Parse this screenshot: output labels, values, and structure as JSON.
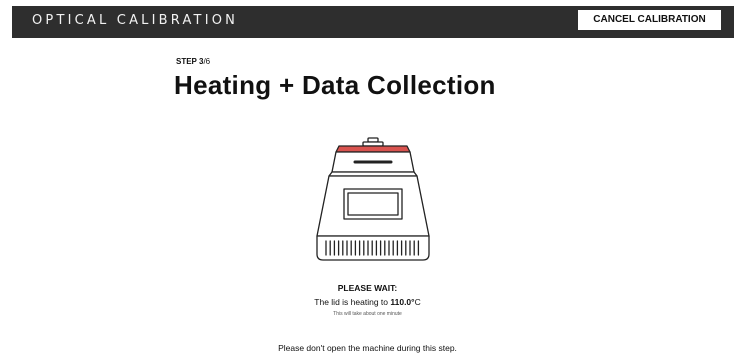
{
  "header": {
    "title": "OPTICAL CALIBRATION",
    "cancel_label": "CANCEL CALIBRATION"
  },
  "step": {
    "prefix": "STEP ",
    "current": "3",
    "total": "/6"
  },
  "main": {
    "title": "Heating + Data Collection"
  },
  "status": {
    "heading": "PLEASE WAIT:",
    "heating_prefix": "The lid is heating to ",
    "temperature": "110.0°",
    "unit": "C",
    "duration_note": "This will take about one minute"
  },
  "footer": {
    "warning": "Please don't open the machine during this step."
  },
  "colors": {
    "header_bg": "#2e2e2e",
    "lid_accent": "#d9534f"
  },
  "illustration": {
    "icon": "thermal-cycler-icon"
  }
}
